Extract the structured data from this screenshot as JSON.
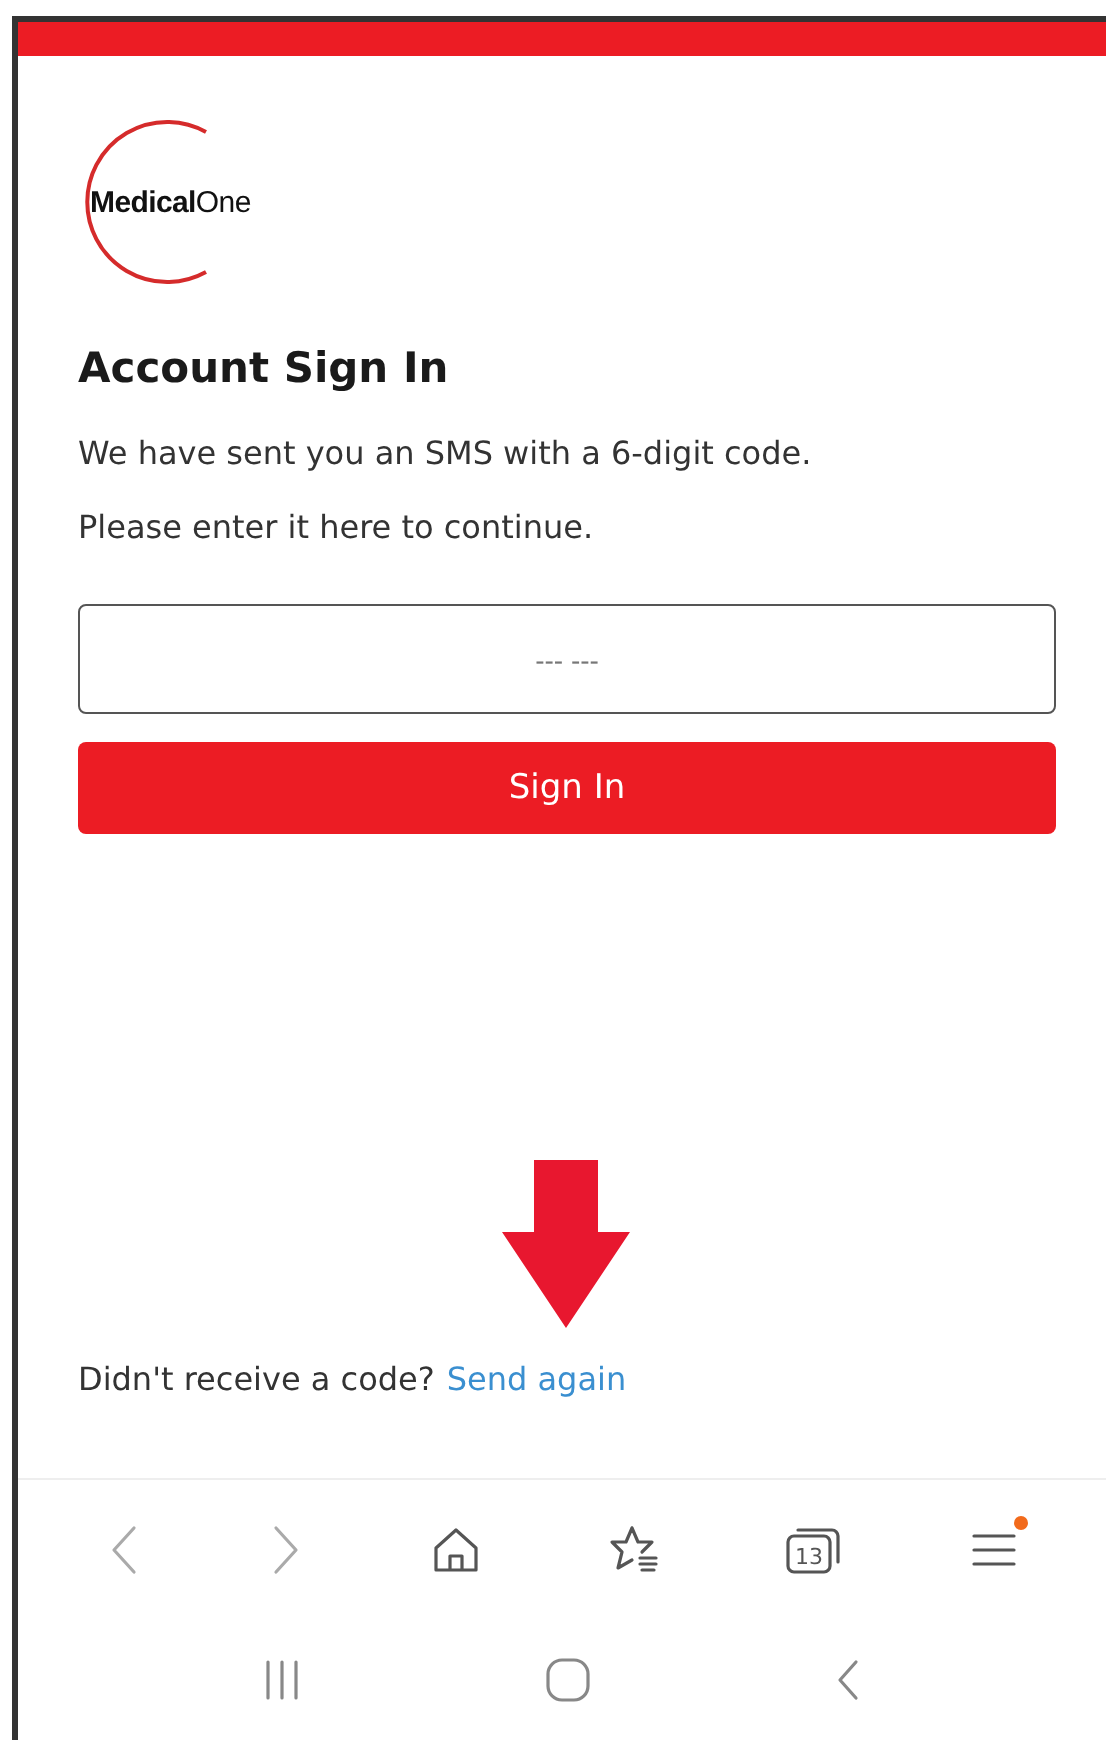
{
  "logo": {
    "text": "**Medical**One"
  },
  "title": "Account Sign In",
  "instructions": [
    "We have sent you an SMS with a 6-digit code.",
    "Please enter it here to continue."
  ],
  "code_field": {
    "placeholder": "--- ---"
  },
  "sign_in_button": "Sign In",
  "resend": {
    "prompt": "Didn't receive a code?",
    "link": "Send again"
  },
  "browser_bar": {
    "tab_count": "13",
    "menu_notification": true
  }
}
